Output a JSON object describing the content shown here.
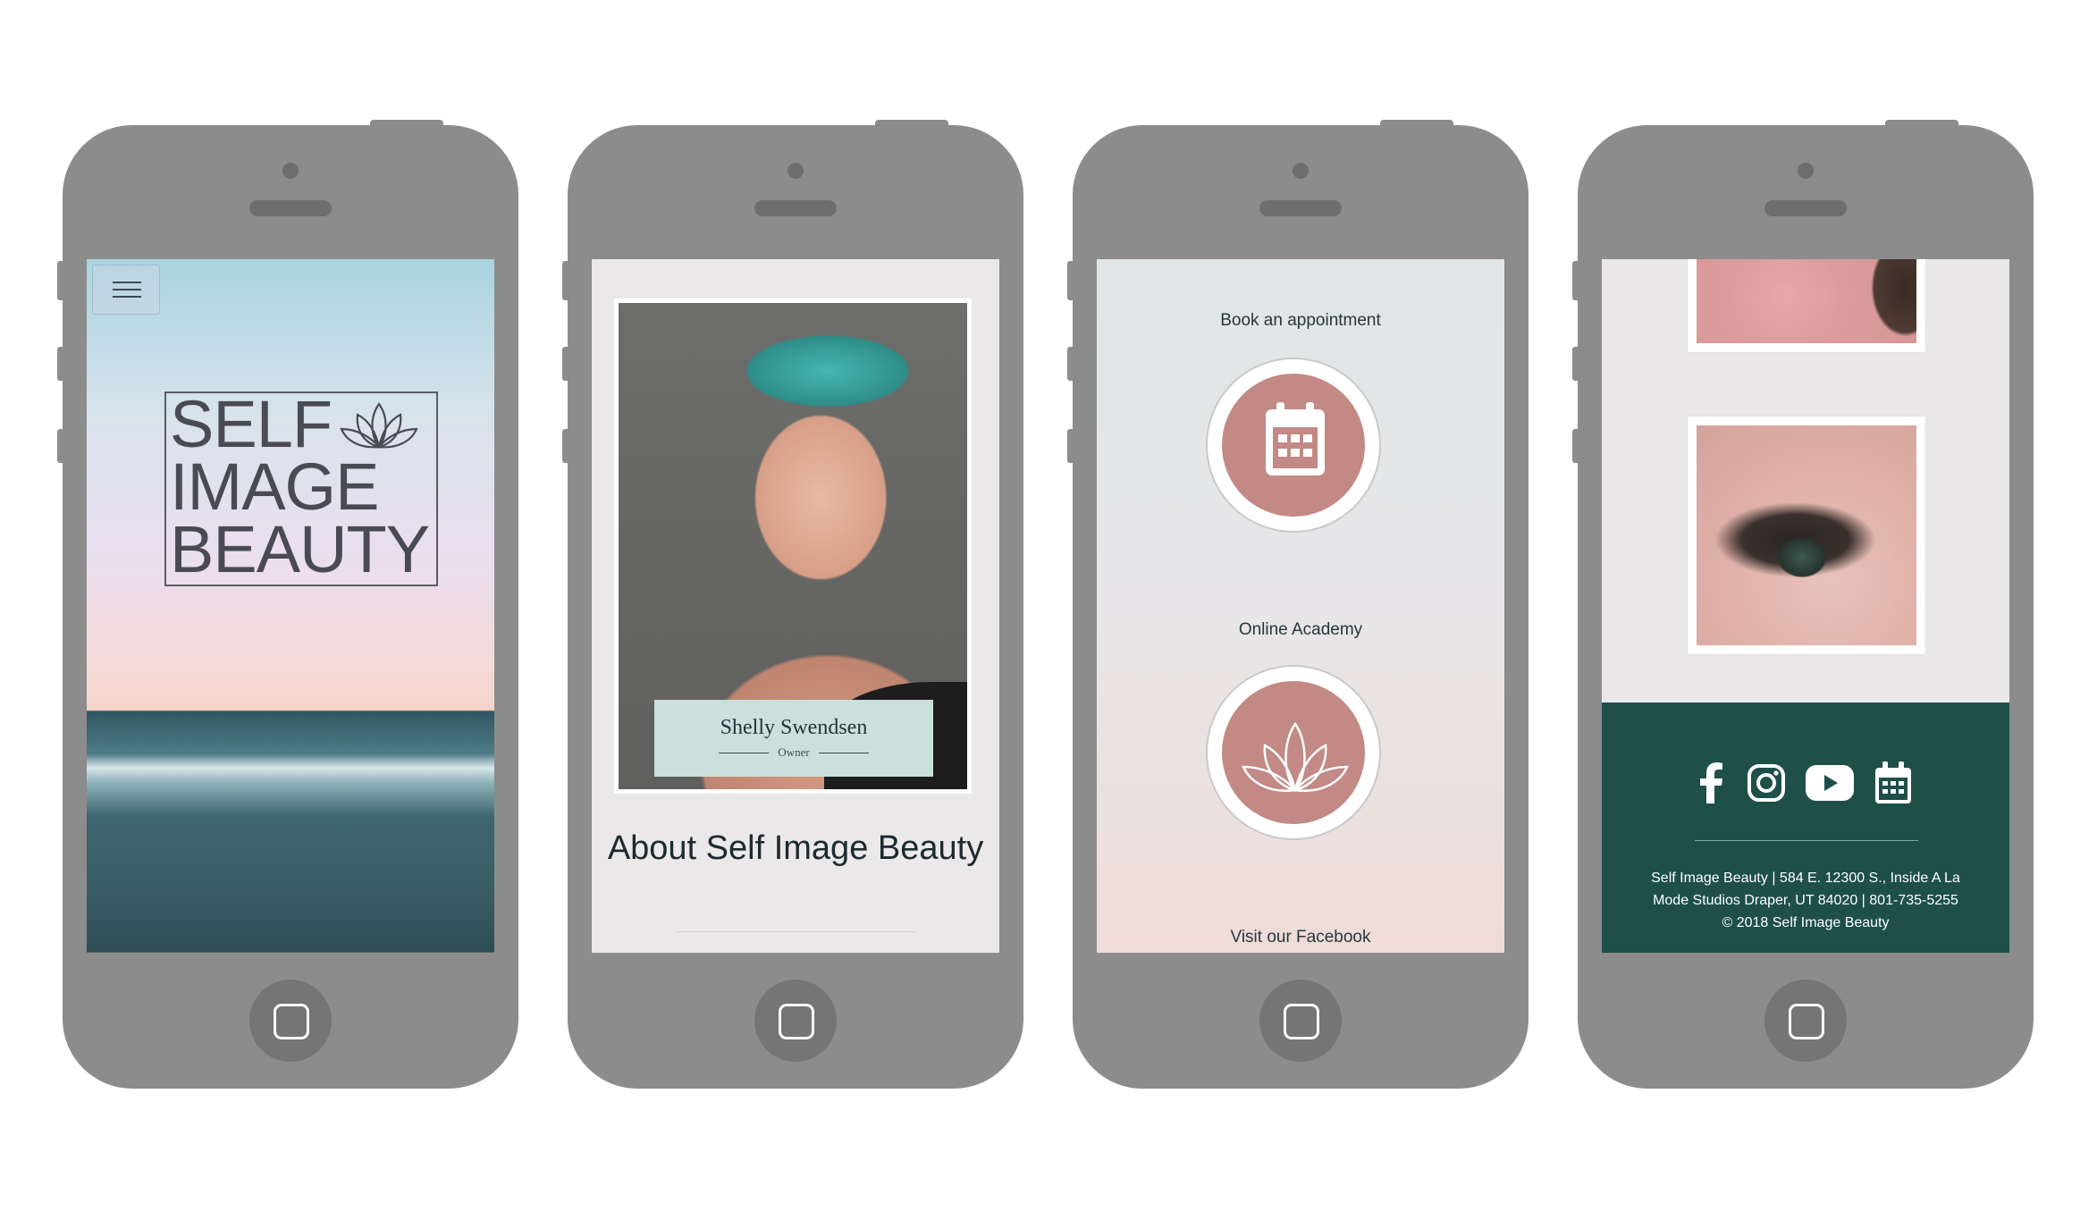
{
  "screens": {
    "hero": {
      "logo_lines": [
        "SELF",
        "IMAGE",
        "BEAUTY"
      ]
    },
    "about": {
      "name": "Shelly Swendsen",
      "role": "Owner",
      "title": "About Self Image Beauty"
    },
    "services": {
      "book_label": "Book an appointment",
      "academy_label": "Online Academy",
      "facebook_label": "Visit our Facebook"
    },
    "footer": {
      "text": "Self Image Beauty | 584 E. 12300 S., Inside A La Mode Studios Draper, UT 84020 | 801-735-5255 © 2018 Self Image Beauty",
      "icons": [
        "facebook-icon",
        "instagram-icon",
        "youtube-icon",
        "calendar-icon"
      ]
    }
  },
  "colors": {
    "phone_body": "#8c8c8c",
    "accent_rose": "#c28985",
    "footer_green": "#1e4f49",
    "name_card_mint": "#c9e0dc"
  }
}
